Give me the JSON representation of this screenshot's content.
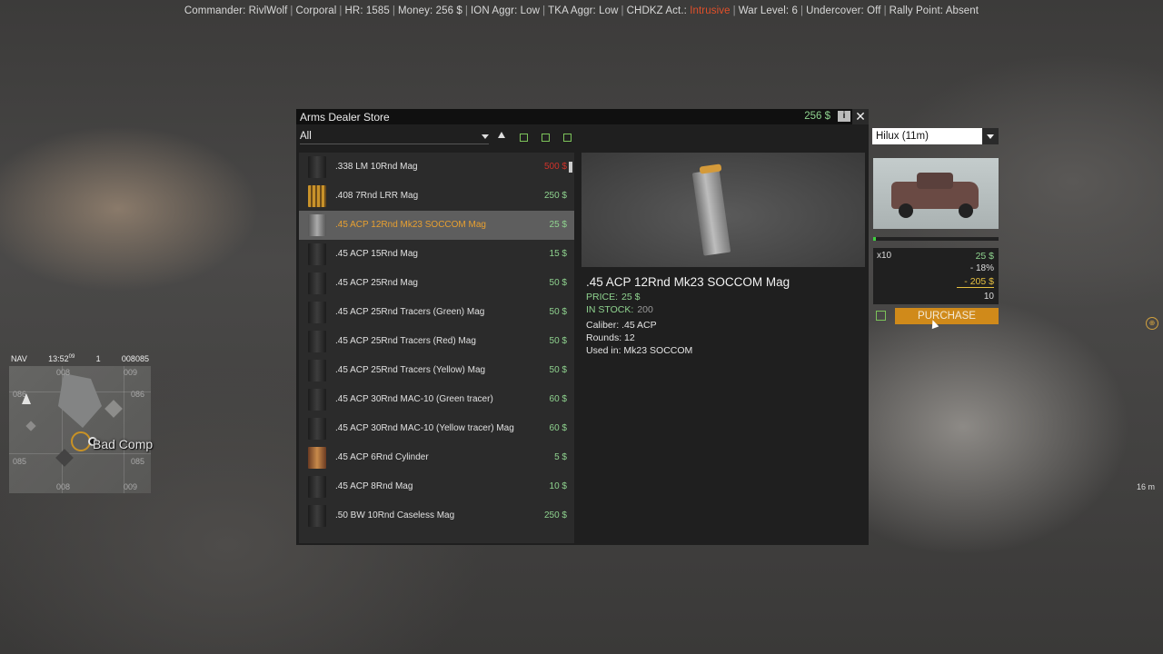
{
  "status_bar": [
    {
      "text": "Commander: RivlWolf",
      "warn": false
    },
    {
      "text": "Corporal",
      "warn": false
    },
    {
      "text": "HR: 1585",
      "warn": false
    },
    {
      "text": "Money: 256 $",
      "warn": false
    },
    {
      "text": "ION Aggr: Low",
      "warn": false
    },
    {
      "text": "TKA Aggr: Low",
      "warn": false
    },
    {
      "text": "CHDKZ Act.: ",
      "value": "Intrusive",
      "warn": true
    },
    {
      "text": "War Level: 6",
      "warn": false
    },
    {
      "text": "Undercover: Off",
      "warn": false
    },
    {
      "text": "Rally Point: Absent",
      "warn": false
    }
  ],
  "minimap": {
    "nav_label": "NAV",
    "time": "13:52",
    "time_seconds": "09",
    "channel": "1",
    "grid_ref": "008085",
    "grid_numbers": {
      "top_left": "008",
      "top_right": "009",
      "mid_left": "086",
      "mid_right": "086",
      "low_left": "085",
      "low_right": "085",
      "bottom_left": "008",
      "bottom_right": "009"
    },
    "marker_label": "Bad Comp"
  },
  "store": {
    "title": "Arms Dealer Store",
    "money": "256 $",
    "info_label": "i",
    "close_label": "✕",
    "filter": "All",
    "items": [
      {
        "name": ".338 LM 10Rnd Mag",
        "price": "500 $",
        "affordable": false,
        "icon": "magazine-icon"
      },
      {
        "name": ".408 7Rnd LRR Mag",
        "price": "250 $",
        "affordable": true,
        "icon": "cartridges-icon"
      },
      {
        "name": ".45 ACP 12Rnd Mk23 SOCCOM Mag",
        "price": "25 $",
        "affordable": true,
        "icon": "pistol-mag-icon",
        "selected": true
      },
      {
        "name": ".45 ACP 15Rnd Mag",
        "price": "15 $",
        "affordable": true,
        "icon": "magazine-icon"
      },
      {
        "name": ".45 ACP 25Rnd Mag",
        "price": "50 $",
        "affordable": true,
        "icon": "magazine-icon"
      },
      {
        "name": ".45 ACP 25Rnd Tracers (Green) Mag",
        "price": "50 $",
        "affordable": true,
        "icon": "magazine-icon"
      },
      {
        "name": ".45 ACP 25Rnd Tracers (Red) Mag",
        "price": "50 $",
        "affordable": true,
        "icon": "magazine-icon"
      },
      {
        "name": ".45 ACP 25Rnd Tracers (Yellow) Mag",
        "price": "50 $",
        "affordable": true,
        "icon": "magazine-icon"
      },
      {
        "name": ".45 ACP 30Rnd MAC-10 (Green tracer)",
        "price": "60 $",
        "affordable": true,
        "icon": "magazine-icon"
      },
      {
        "name": ".45 ACP 30Rnd MAC-10 (Yellow tracer) Mag",
        "price": "60 $",
        "affordable": true,
        "icon": "magazine-icon"
      },
      {
        "name": ".45 ACP 6Rnd Cylinder",
        "price": "5 $",
        "affordable": true,
        "icon": "cylinder-icon"
      },
      {
        "name": ".45 ACP 8Rnd Mag",
        "price": "10 $",
        "affordable": true,
        "icon": "magazine-icon"
      },
      {
        "name": ".50 BW 10Rnd Caseless Mag",
        "price": "250 $",
        "affordable": true,
        "icon": "magazine-icon"
      }
    ],
    "detail": {
      "title": ".45 ACP 12Rnd Mk23 SOCCOM Mag",
      "price_label": "PRICE:",
      "price_value": "25 $",
      "stock_label": "IN STOCK:",
      "stock_value": "200",
      "caliber": "Caliber: .45 ACP",
      "rounds": "Rounds: 12",
      "used_in": "Used in: Mk23 SOCCOM"
    }
  },
  "vehicle": {
    "selected": "Hilux (11m)",
    "load_fraction": 0.02,
    "quantity": "x10",
    "unit_price": "25 $",
    "discount": "- 18%",
    "total": "- 205 $",
    "count": "10",
    "purchase_label": "PURCHASE"
  },
  "hud": {
    "distance": "16 m"
  },
  "colors": {
    "accent_orange": "#d08a1a",
    "price_green": "#8fd38f",
    "price_red": "#d0322a",
    "warn_red": "#e0502a"
  }
}
